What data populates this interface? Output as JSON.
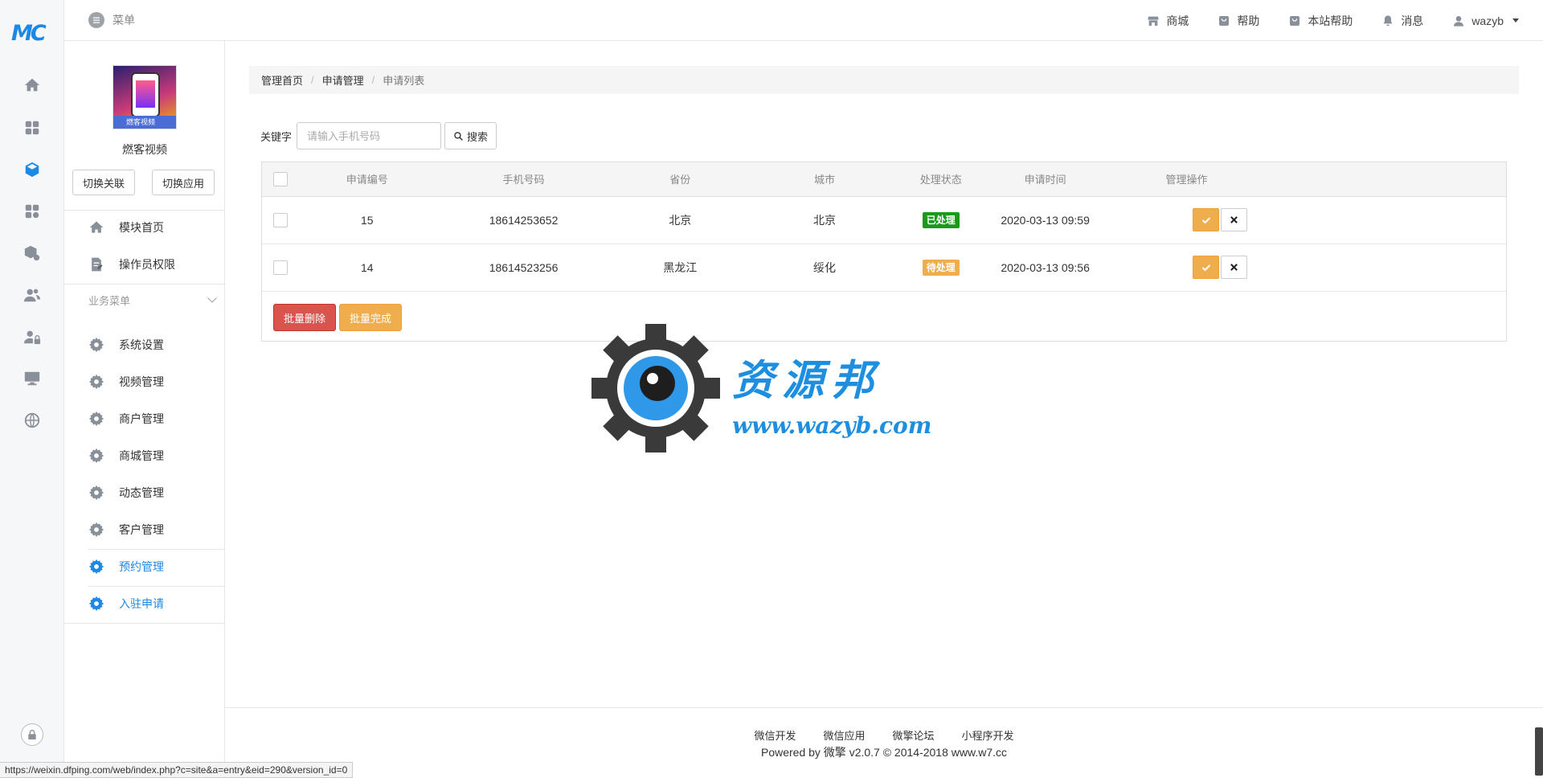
{
  "rail": {
    "logo": "MC",
    "icons": [
      "home-icon",
      "grid-icon",
      "cube-icon",
      "apps-gear-icon",
      "box-gear-icon",
      "users-icon",
      "user-lock-icon",
      "monitor-icon",
      "globe-icon"
    ],
    "active_index": 2
  },
  "topbar": {
    "menu_label": "菜单",
    "nav": [
      {
        "label": "商城",
        "icon": "store-icon"
      },
      {
        "label": "帮助",
        "icon": "bag-icon"
      },
      {
        "label": "本站帮助",
        "icon": "bag-icon"
      },
      {
        "label": "消息",
        "icon": "bell-icon"
      }
    ],
    "user": "wazyb"
  },
  "sidebar": {
    "avatar_caption": "燃客视频",
    "app_name": "燃客视频",
    "switch_link_label": "切换关联",
    "switch_app_label": "切换应用",
    "top_items": [
      {
        "label": "模块首页",
        "icon": "home-icon"
      },
      {
        "label": "操作员权限",
        "icon": "document-edit-icon"
      }
    ],
    "group_label": "业务菜单",
    "menu_items": [
      {
        "label": "系统设置",
        "active": false
      },
      {
        "label": "视频管理",
        "active": false
      },
      {
        "label": "商户管理",
        "active": false
      },
      {
        "label": "商城管理",
        "active": false
      },
      {
        "label": "动态管理",
        "active": false
      },
      {
        "label": "客户管理",
        "active": false
      },
      {
        "label": "预约管理",
        "active": true
      },
      {
        "label": "入驻申请",
        "active": true
      }
    ]
  },
  "breadcrumb": {
    "items": [
      "管理首页",
      "申请管理"
    ],
    "current": "申请列表"
  },
  "search": {
    "label": "关键字",
    "placeholder": "请输入手机号码",
    "value": "",
    "button_label": "搜索"
  },
  "table": {
    "columns": [
      "申请编号",
      "手机号码",
      "省份",
      "城市",
      "处理状态",
      "申请时间",
      "管理操作"
    ],
    "rows": [
      {
        "id": "15",
        "phone": "18614253652",
        "province": "北京",
        "city": "北京",
        "status": "已处理",
        "status_color": "#1a9a1a",
        "time": "2020-03-13 09:59"
      },
      {
        "id": "14",
        "phone": "18614523256",
        "province": "黑龙江",
        "city": "绥化",
        "status": "待处理",
        "status_color": "#f0ad4e",
        "time": "2020-03-13 09:56"
      }
    ],
    "bulk_delete_label": "批量删除",
    "bulk_complete_label": "批量完成"
  },
  "watermark": {
    "text": "资源邦",
    "url": "www.wazyb.com"
  },
  "footer": {
    "links": [
      "微信开发",
      "微信应用",
      "微擎论坛",
      "小程序开发"
    ],
    "copyright": "Powered by 微擎 v2.0.7 © 2014-2018 www.w7.cc"
  },
  "status_url": "https://weixin.dfping.com/web/index.php?c=site&a=entry&eid=290&version_id=0",
  "colors": {
    "accent": "#1e88e5",
    "danger": "#d9534f",
    "warning": "#f0ad4e",
    "success": "#1a9a1a"
  }
}
